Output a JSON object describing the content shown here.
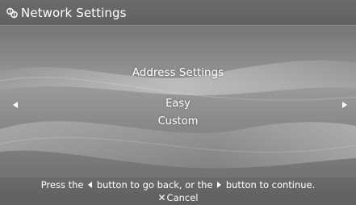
{
  "window": {
    "title": "Network Settings",
    "title_icon": "network-globe-icon"
  },
  "main": {
    "heading": "Address Settings",
    "options": [
      {
        "label": "Easy",
        "selected": true
      },
      {
        "label": "Custom",
        "selected": false
      }
    ],
    "left_arrow_icon": "left-arrow-icon",
    "right_arrow_icon": "right-arrow-icon"
  },
  "footer": {
    "hint_part1": "Press the",
    "hint_part2": "button to go back, or the",
    "hint_part3": "button to continue.",
    "cancel_symbol": "✕",
    "cancel_label": "Cancel"
  },
  "colors": {
    "background": "#8a8a8a",
    "bar": "#656565",
    "text": "#ffffff"
  }
}
